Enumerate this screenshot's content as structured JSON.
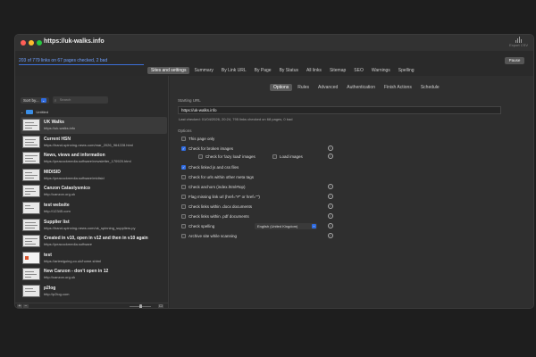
{
  "window": {
    "title": "https://uk-walks.info",
    "export_label": "Export CSV"
  },
  "status": {
    "text": "203 of 779 links on 67 pages checked, 2 bad",
    "pause_label": "Pause"
  },
  "main_tabs": [
    "Sites and settings",
    "Summary",
    "By Link URL",
    "By Page",
    "By Status",
    "All links",
    "Sitemap",
    "SEO",
    "Warnings",
    "Spelling"
  ],
  "sidebar": {
    "sort_label": "Sort by...",
    "search_placeholder": "Search",
    "folder_label": "Untitled",
    "sites": [
      {
        "name": "UK Walks",
        "url": "https://uk-walks.info"
      },
      {
        "name": "Current HSN",
        "url": "https://hand-spinning-news.com/mar_2026_964228.html"
      },
      {
        "name": "News, views and information",
        "url": "https://peacockmedia.software/newsletter_170920.html"
      },
      {
        "name": "MIDISID",
        "url": "https://peacockmedia.software/midisid"
      },
      {
        "name": "Canzon Cataolysmico",
        "url": "http://canzon.org.uk"
      },
      {
        "name": "test website",
        "url": "http://12345.com"
      },
      {
        "name": "Supplier list",
        "url": "https://hand-spinning-news.com/uk_spinning_suppliers.py"
      },
      {
        "name": "Created in v10, open in v12 and then in v10 again",
        "url": "https://peacockmedia.software"
      },
      {
        "name": "test",
        "url": "https://ariestgoing.co.uk/home.shtml"
      },
      {
        "name": "New Canzon - don't open in 12",
        "url": "http://canzon.org.uk"
      },
      {
        "name": "p2log",
        "url": "http://p2log.com"
      }
    ]
  },
  "settings": {
    "sub_tabs": [
      "Options",
      "Rules",
      "Advanced",
      "Authentication",
      "Finish Actions",
      "Schedule"
    ],
    "starting_url_label": "Starting URL",
    "starting_url": "https://uk-walks.info",
    "last_checked": "Last checked: 01/04/2026, 20:24, 795 links checked on 68 pages, 0 bad",
    "options_label": "Options",
    "options": [
      {
        "label": "This page only",
        "checked": false
      },
      {
        "label": "Check for broken images",
        "checked": true
      },
      {
        "label": "Check linked js and css files",
        "checked": true
      },
      {
        "label": "Check for urls within other meta tags",
        "checked": false
      },
      {
        "label": "Check anchors (index.html#top)",
        "checked": false
      },
      {
        "label": "Flag missing link url (href=\"#\" or href=\"\")",
        "checked": false
      },
      {
        "label": "Check links within .docx documents",
        "checked": false
      },
      {
        "label": "Check links within .pdf documents",
        "checked": false
      },
      {
        "label": "Check spelling",
        "checked": false
      },
      {
        "label": "Archive site while scanning",
        "checked": false
      }
    ],
    "lazy_load_label": "Check for 'lazy load' images",
    "load_images_label": "Load images",
    "spelling_language": "English (United Kingdom)"
  }
}
